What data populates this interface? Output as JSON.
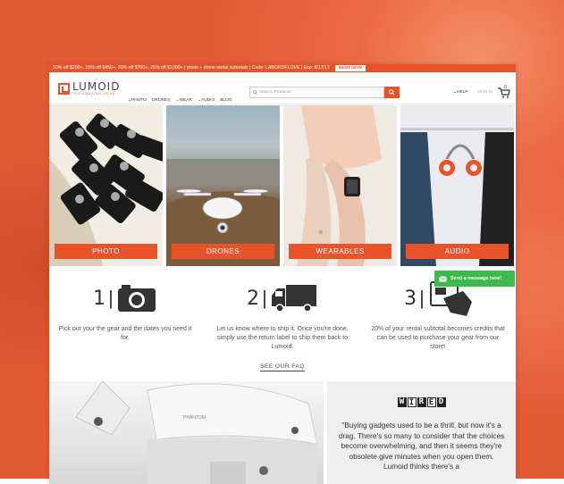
{
  "promo": {
    "text": "10% off $200+, 15% off $450+, 20% off $700+, 25% off $1000+ | photo + drone rental subtotals | Code: LABORDFLOVE | Exp: 9/17/17",
    "rent_now": "RENT NOW"
  },
  "header": {
    "logo_name": "LUMOID",
    "logo_tagline": "TRY AMAZING GEAR",
    "nav": [
      "PHOTO",
      "DRONES",
      "WEAR",
      "AUDIO",
      "BLOG"
    ],
    "search_placeholder": "Search Products",
    "help": "HELP",
    "sign_in": "SIGN IN",
    "cart_count": "0"
  },
  "categories": [
    "PHOTO",
    "DRONES",
    "WEARABLES",
    "AUDIO"
  ],
  "steps": [
    {
      "num": "1",
      "text": "Pick out your the gear and the dates you need it for."
    },
    {
      "num": "2",
      "text": "Let us know where to ship it. Once you're done, simply use the return label to ship them back to Lumoid."
    },
    {
      "num": "3",
      "text": "20% of your rental subtotal becomes credits that can be used to purchase your gear from our store!"
    }
  ],
  "faq_link": "SEE OUR FAQ",
  "message_button": "Send a message here!",
  "drone_brand": "PHANTOM",
  "press": {
    "logo": "WIRED",
    "quote": "\"Buying gadgets used to be a thrill, but now it's a drag. There's so many to consider that the choices become overwhelming, and then it seems they're obsolete give minutes when you open them. Lumoid thinks there's a"
  },
  "colors": {
    "brand": "#e8532a",
    "message_green": "#3cbb4c"
  }
}
